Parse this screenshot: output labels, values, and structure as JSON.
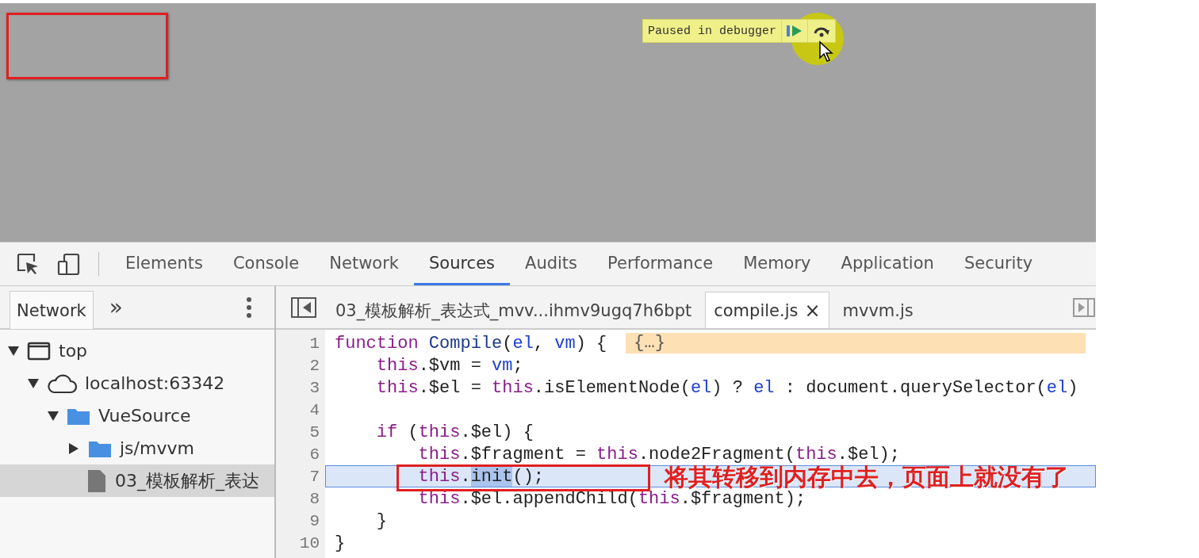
{
  "debugger_banner": {
    "label": "Paused in debugger"
  },
  "devtools_tabs": [
    {
      "label": "Elements",
      "selected": false
    },
    {
      "label": "Console",
      "selected": false
    },
    {
      "label": "Network",
      "selected": false
    },
    {
      "label": "Sources",
      "selected": true
    },
    {
      "label": "Audits",
      "selected": false
    },
    {
      "label": "Performance",
      "selected": false
    },
    {
      "label": "Memory",
      "selected": false
    },
    {
      "label": "Application",
      "selected": false
    },
    {
      "label": "Security",
      "selected": false
    }
  ],
  "navigator": {
    "tabs": [
      {
        "label": "Network",
        "selected": true
      }
    ],
    "more": "»"
  },
  "file_tree": [
    {
      "label": "top",
      "kind": "frame",
      "expanded": true,
      "selected": false,
      "children": [
        {
          "label": "localhost:63342",
          "kind": "origin",
          "expanded": true,
          "selected": false,
          "children": [
            {
              "label": "VueSource",
              "kind": "folder",
              "expanded": true,
              "selected": false,
              "children": [
                {
                  "label": "js/mvvm",
                  "kind": "folder",
                  "expanded": false,
                  "selected": false
                },
                {
                  "label": "03_模板解析_表达",
                  "kind": "file",
                  "selected": true
                }
              ]
            }
          ]
        }
      ]
    }
  ],
  "editor_tabs": [
    {
      "label": "03_模板解析_表达式_mvv...ihmv9ugq7h6bpt",
      "selected": false
    },
    {
      "label": "compile.js",
      "selected": true,
      "close": "×"
    },
    {
      "label": "mvvm.js",
      "selected": false
    }
  ],
  "code": {
    "inline_value": "{…}",
    "annotation": "将其转移到内存中去，页面上就没有了",
    "lines": [
      {
        "number": "1",
        "selected": false,
        "tokens": [
          {
            "text": "function ",
            "kind": "kw"
          },
          {
            "text": "Compile",
            "kind": "def"
          },
          {
            "text": "(",
            "kind": "plain"
          },
          {
            "text": "el",
            "kind": "var"
          },
          {
            "text": ", ",
            "kind": "plain"
          },
          {
            "text": "vm",
            "kind": "var"
          },
          {
            "text": ") {",
            "kind": "plain"
          }
        ]
      },
      {
        "number": "2",
        "selected": false,
        "tokens": [
          {
            "text": "    this",
            "kind": "kw"
          },
          {
            "text": ".$vm = ",
            "kind": "plain"
          },
          {
            "text": "vm",
            "kind": "var"
          },
          {
            "text": ";",
            "kind": "plain"
          }
        ]
      },
      {
        "number": "3",
        "selected": false,
        "tokens": [
          {
            "text": "    this",
            "kind": "kw"
          },
          {
            "text": ".$el = ",
            "kind": "plain"
          },
          {
            "text": "this",
            "kind": "kw"
          },
          {
            "text": ".isElementNode(",
            "kind": "plain"
          },
          {
            "text": "el",
            "kind": "var"
          },
          {
            "text": ") ? ",
            "kind": "plain"
          },
          {
            "text": "el",
            "kind": "var"
          },
          {
            "text": " : document.querySelector(",
            "kind": "plain"
          },
          {
            "text": "el",
            "kind": "var"
          },
          {
            "text": ")",
            "kind": "plain"
          }
        ]
      },
      {
        "number": "4",
        "selected": false
      },
      {
        "number": "5",
        "selected": false,
        "tokens": [
          {
            "text": "    if",
            "kind": "kw"
          },
          {
            "text": " (",
            "kind": "plain"
          },
          {
            "text": "this",
            "kind": "kw"
          },
          {
            "text": ".$el) {",
            "kind": "plain"
          }
        ]
      },
      {
        "number": "6",
        "selected": false,
        "tokens": [
          {
            "text": "        this",
            "kind": "kw"
          },
          {
            "text": ".$fragment = ",
            "kind": "plain"
          },
          {
            "text": "this",
            "kind": "kw"
          },
          {
            "text": ".node2Fragment(",
            "kind": "plain"
          },
          {
            "text": "this",
            "kind": "kw"
          },
          {
            "text": ".$el);",
            "kind": "plain"
          }
        ]
      },
      {
        "number": "7",
        "selected": true,
        "tokens": [
          {
            "text": "        this",
            "kind": "kw"
          },
          {
            "text": ".",
            "kind": "plain"
          },
          {
            "text": "init",
            "kind": "selection"
          },
          {
            "text": "();",
            "kind": "plain"
          }
        ]
      },
      {
        "number": "8",
        "selected": false,
        "tokens": [
          {
            "text": "        this",
            "kind": "kw"
          },
          {
            "text": ".$el.appendChild(",
            "kind": "plain"
          },
          {
            "text": "this",
            "kind": "kw"
          },
          {
            "text": ".$fragment);",
            "kind": "plain"
          }
        ]
      },
      {
        "number": "9",
        "selected": false,
        "tokens": [
          {
            "text": "    }",
            "kind": "plain"
          }
        ]
      },
      {
        "number": "10",
        "selected": false,
        "tokens": [
          {
            "text": "}",
            "kind": "plain"
          }
        ]
      }
    ]
  }
}
